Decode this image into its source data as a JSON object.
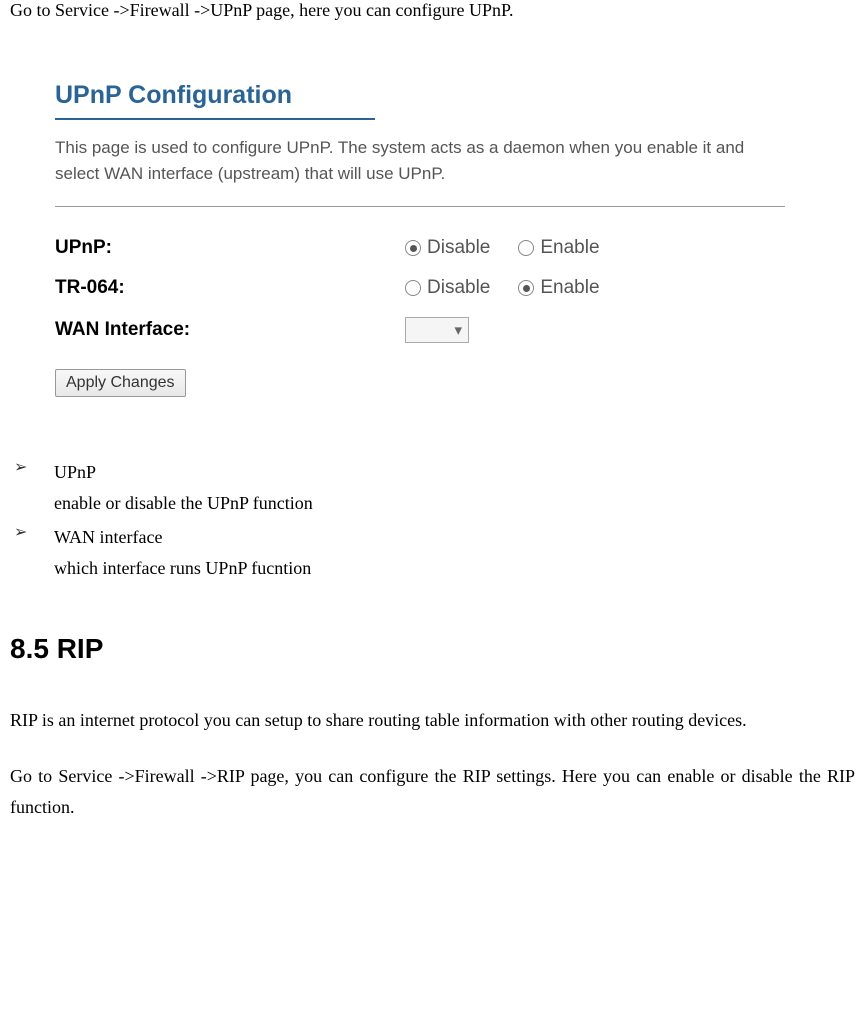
{
  "intro": "Go to Service ->Firewall ->UPnP page, here you can configure UPnP.",
  "config": {
    "title": "UPnP Configuration",
    "description": "This page is used to configure UPnP. The system acts as a daemon when you enable it and select WAN interface (upstream) that will use UPnP.",
    "rows": {
      "upnp_label": "UPnP:",
      "tr064_label": "TR-064:",
      "wan_label": "WAN Interface:",
      "disable": "Disable",
      "enable": "Enable"
    },
    "button": "Apply Changes"
  },
  "bullets": [
    {
      "title": "UPnP",
      "desc": "enable or disable the UPnP function"
    },
    {
      "title": "WAN interface",
      "desc": "which interface runs UPnP fucntion"
    }
  ],
  "section_heading": "8.5 RIP",
  "para1": "RIP is an internet protocol you can setup to share routing table information with other routing devices.",
  "para2": "Go to Service ->Firewall ->RIP page, you can configure the RIP settings. Here you can enable or disable the RIP function."
}
